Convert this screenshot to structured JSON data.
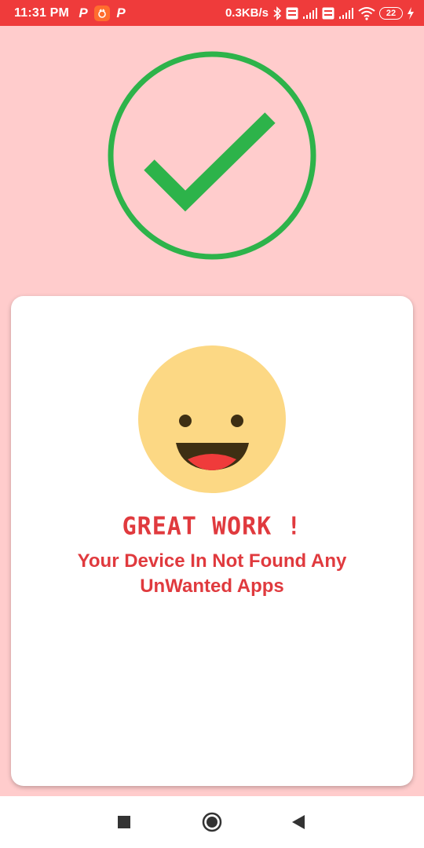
{
  "status_bar": {
    "time": "11:31 PM",
    "p_label_1": "P",
    "p_label_2": "P",
    "net_speed": "0.3KB/s",
    "battery_level": "22",
    "icons": [
      "p-icon",
      "app-notification-icon",
      "p-icon",
      "bluetooth-icon",
      "volte-icon",
      "signal-icon",
      "volte-icon",
      "signal-icon",
      "wifi-icon",
      "battery-icon",
      "charging-icon"
    ]
  },
  "result": {
    "icon": "check-circle-icon",
    "emoji": "grinning-face-icon",
    "title": "GREAT WORK !",
    "message": "Your Device In Not Found Any UnWanted Apps"
  },
  "nav": {
    "icons": [
      "recents-square-icon",
      "home-circle-icon",
      "back-triangle-icon"
    ]
  },
  "colors": {
    "status_bar": "#ef3b3b",
    "background": "#ffcccc",
    "check_green": "#2db34a",
    "text_red": "#e03a3e",
    "emoji_face": "#fcd884"
  }
}
